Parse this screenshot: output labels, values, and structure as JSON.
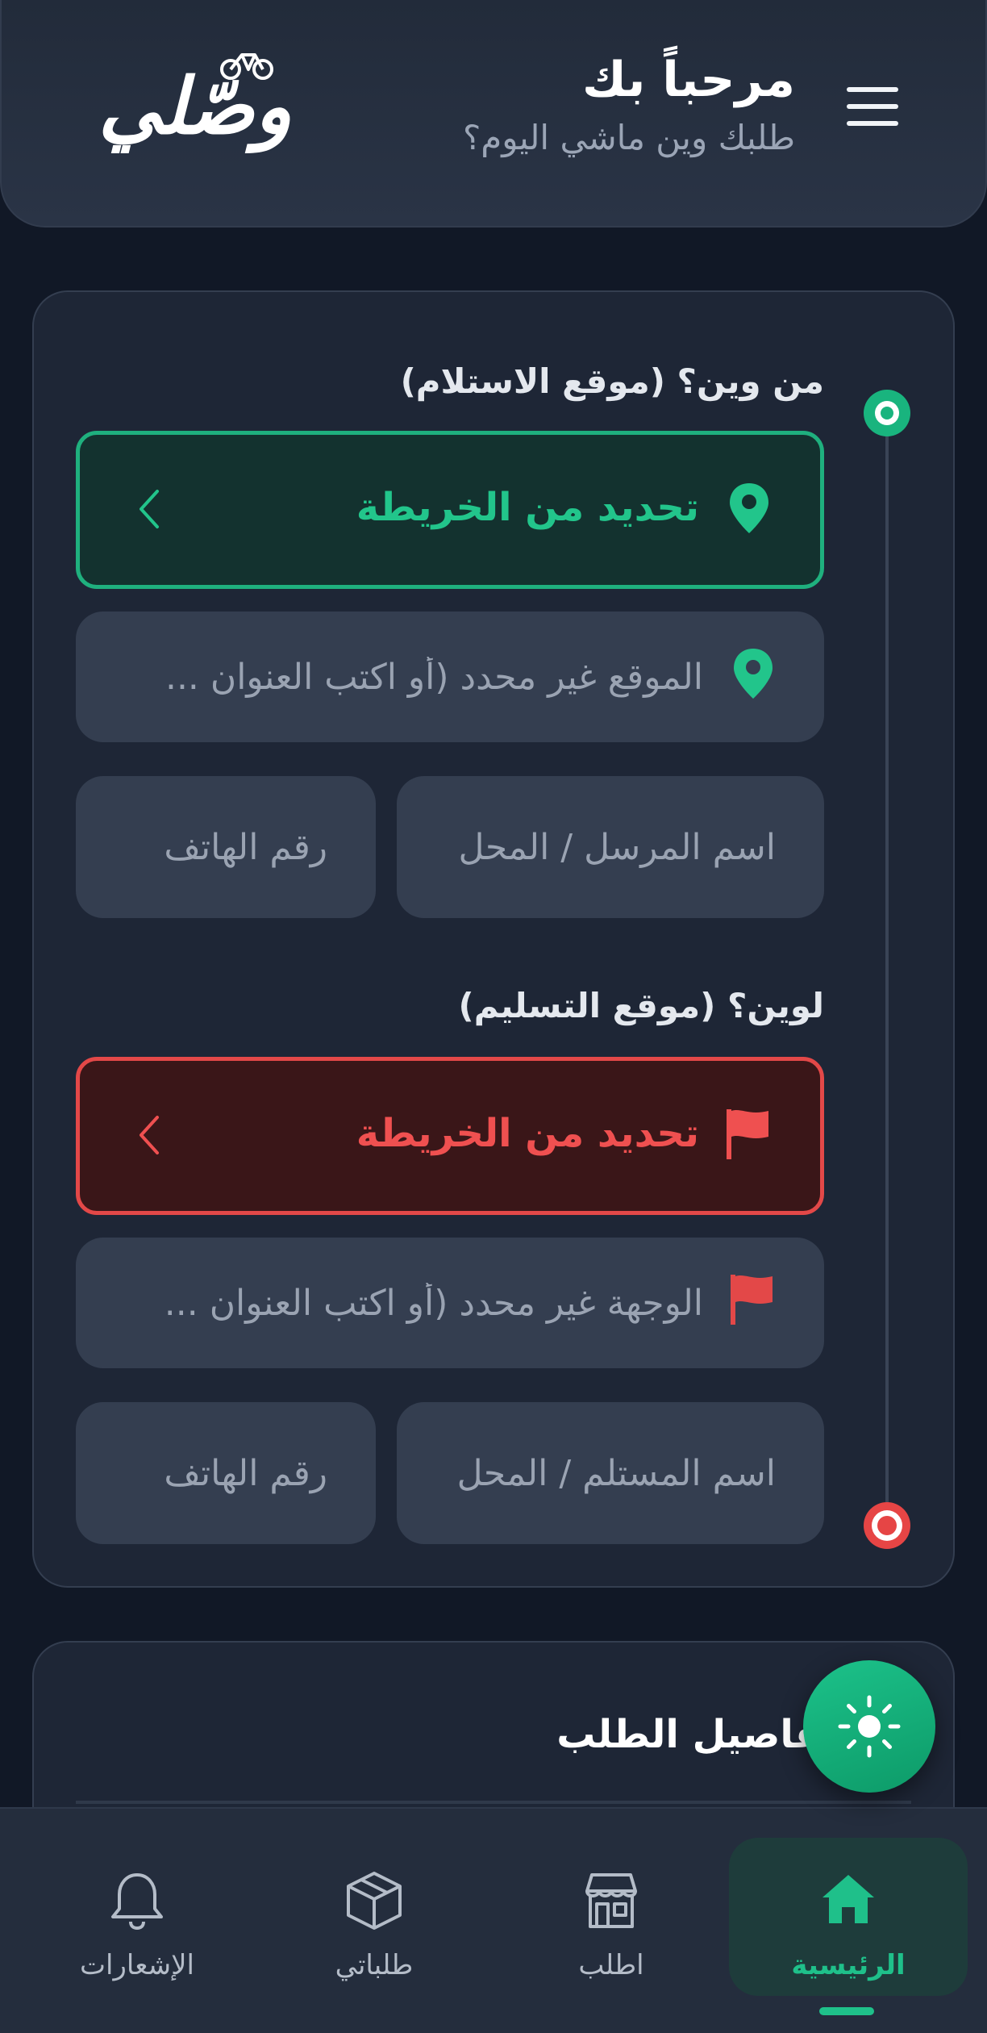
{
  "header": {
    "title": "مرحباً بك",
    "subtitle": "طلبك وين ماشي اليوم؟",
    "logo_text": "وصّلي"
  },
  "pickup": {
    "section_label": "من وين؟ (موقع الاستلام)",
    "map_button_label": "تحديد من الخريطة",
    "address_placeholder": "الموقع غير محدد (أو اكتب العنوان ...",
    "name_placeholder": "اسم المرسل / المحل",
    "phone_placeholder": "رقم الهاتف",
    "accent_color": "#1fb07e"
  },
  "dropoff": {
    "section_label": "لوين؟ (موقع التسليم)",
    "map_button_label": "تحديد من الخريطة",
    "address_placeholder": "الوجهة غير محدد (أو اكتب العنوان ...",
    "name_placeholder": "اسم المستلم / المحل",
    "phone_placeholder": "رقم الهاتف",
    "accent_color": "#e34848"
  },
  "details": {
    "title": "تفاصيل الطلب"
  },
  "fab": {
    "icon": "sun-icon"
  },
  "nav": {
    "items": [
      {
        "label": "الرئيسية",
        "icon": "home-icon",
        "active": true
      },
      {
        "label": "اطلب",
        "icon": "store-icon",
        "active": false
      },
      {
        "label": "طلباتي",
        "icon": "box-icon",
        "active": false
      },
      {
        "label": "الإشعارات",
        "icon": "bell-icon",
        "active": false
      }
    ]
  }
}
